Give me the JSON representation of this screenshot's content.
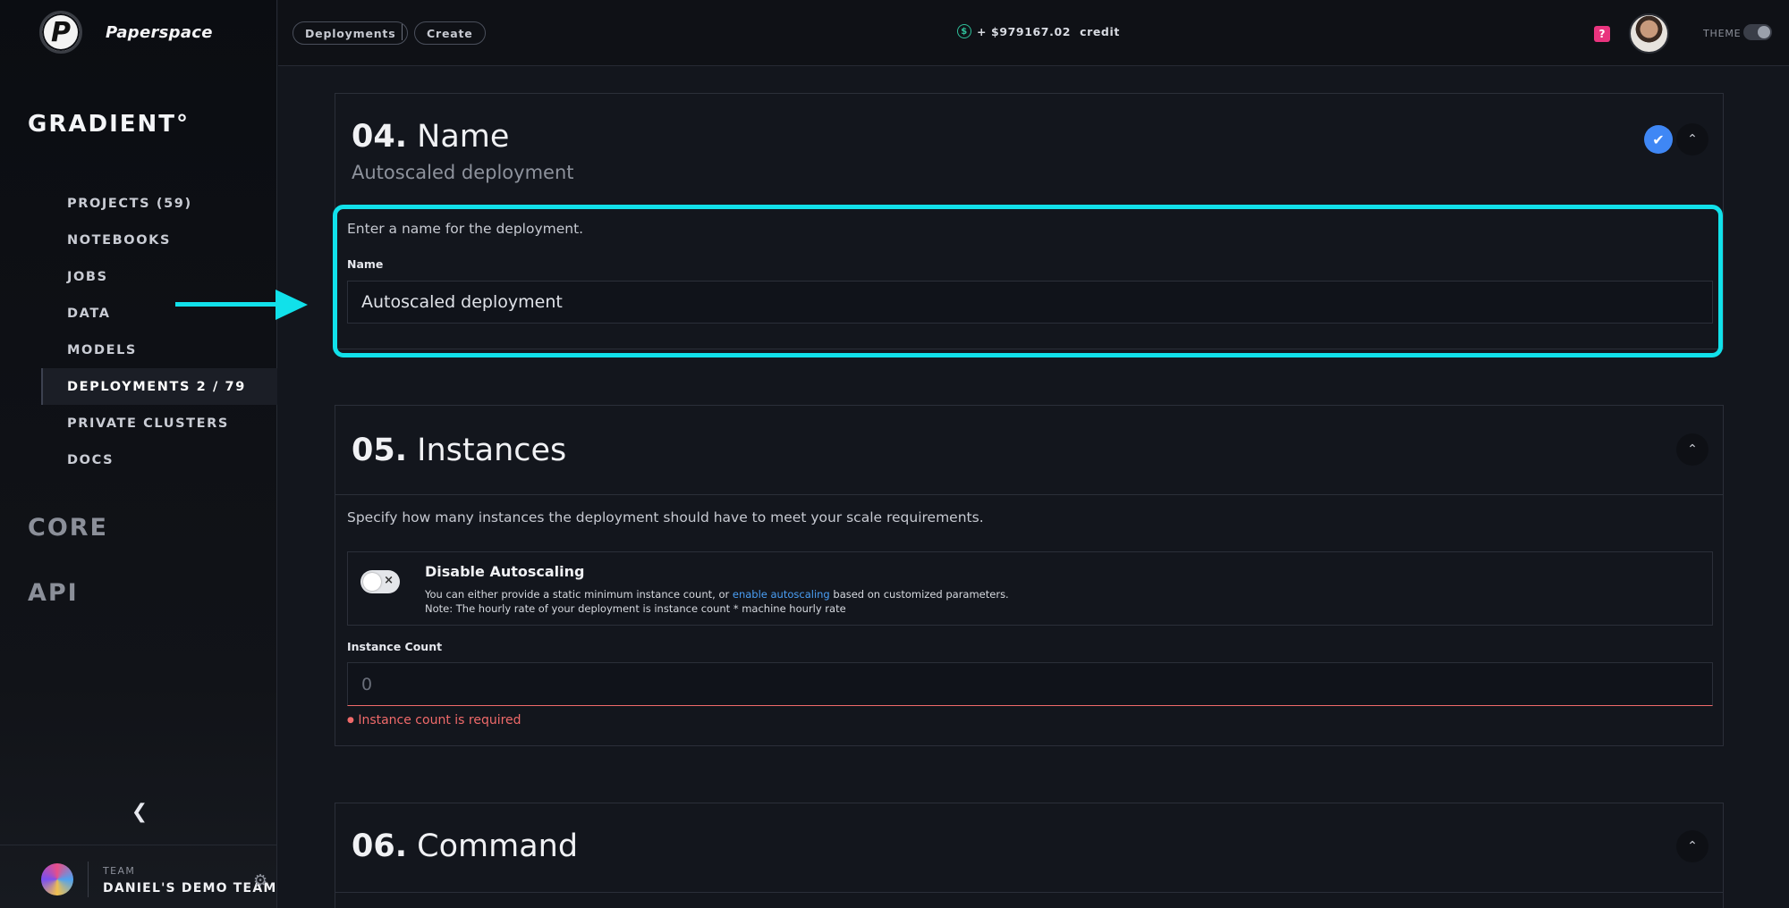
{
  "brand": {
    "name": "Paperspace",
    "logo_letter": "P"
  },
  "sidebar": {
    "product": "GRADIENT°",
    "items": [
      {
        "label": "PROJECTS (59)"
      },
      {
        "label": "NOTEBOOKS"
      },
      {
        "label": "JOBS"
      },
      {
        "label": "DATA"
      },
      {
        "label": "MODELS"
      },
      {
        "label": "DEPLOYMENTS 2 / 79",
        "active": true
      },
      {
        "label": "PRIVATE CLUSTERS"
      },
      {
        "label": "DOCS"
      }
    ],
    "sections": [
      "CORE",
      "API"
    ],
    "collapse_icon": "chevron-left-icon",
    "team": {
      "label": "TEAM",
      "name": "DANIEL'S DEMO TEAM"
    }
  },
  "topbar": {
    "breadcrumbs": [
      "Deployments",
      "Create"
    ],
    "credit_amount": "+ $979167.02",
    "credit_label": "credit",
    "help_glyph": "?",
    "theme_label": "THEME"
  },
  "sections": {
    "name": {
      "number": "04.",
      "title": "Name",
      "subtitle": "Autoscaled deployment",
      "description": "Enter a name for the deployment.",
      "field_label": "Name",
      "field_value": "Autoscaled deployment"
    },
    "instances": {
      "number": "05.",
      "title": "Instances",
      "description": "Specify how many instances the deployment should have to meet your scale requirements.",
      "toggle_title": "Disable Autoscaling",
      "toggle_text_before": "You can either provide a static minimum instance count, or ",
      "toggle_link": "enable autoscaling",
      "toggle_text_after": " based on customized parameters.",
      "toggle_note": "Note: The hourly rate of your deployment is instance count * machine hourly rate",
      "field_label": "Instance Count",
      "field_placeholder": "0",
      "error": "Instance count is required"
    },
    "command": {
      "number": "06.",
      "title": "Command"
    }
  },
  "colors": {
    "accent_highlight": "#11e1ea",
    "check_blue": "#3f87f5",
    "error_red": "#f06a6a",
    "link_blue": "#4a9ff5",
    "help_pink": "#e9347e"
  }
}
